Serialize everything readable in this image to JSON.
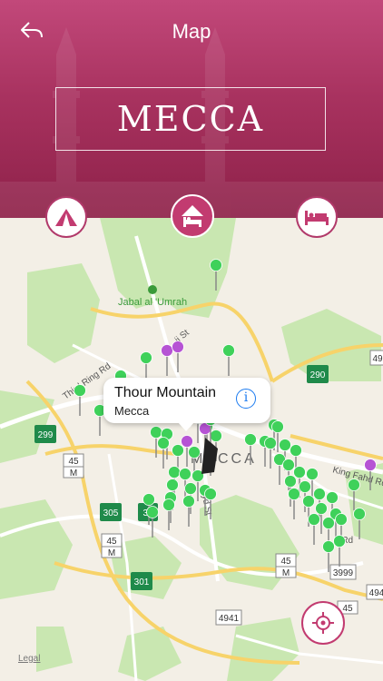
{
  "header": {
    "title": "Map",
    "city": "MECCA",
    "back_icon": "back-arrow-icon"
  },
  "categories": [
    {
      "name": "tent-icon",
      "state": "inactive"
    },
    {
      "name": "hotel-tent-icon",
      "state": "active"
    },
    {
      "name": "bed-icon",
      "state": "inactive"
    }
  ],
  "map": {
    "labels": {
      "jabal": "Jabal al 'Umrah",
      "ring_rd": "Third Ring Rd",
      "city": "MECCA",
      "king_fahd": "King Fahd Rd",
      "st1": "ji St",
      "st2": "ayd St",
      "rd": "n Rd"
    },
    "shields": [
      "290",
      "299",
      "45",
      "M",
      "305",
      "30",
      "45",
      "M",
      "301",
      "45",
      "M",
      "3999",
      "45",
      "4941",
      "49",
      "494"
    ],
    "legal": "Legal"
  },
  "callout": {
    "title": "Thour Mountain",
    "subtitle": "Mecca",
    "info": "i"
  },
  "colors": {
    "accent": "#c23b70",
    "pin_green": "#3fd15a",
    "pin_purple": "#b653d4"
  }
}
